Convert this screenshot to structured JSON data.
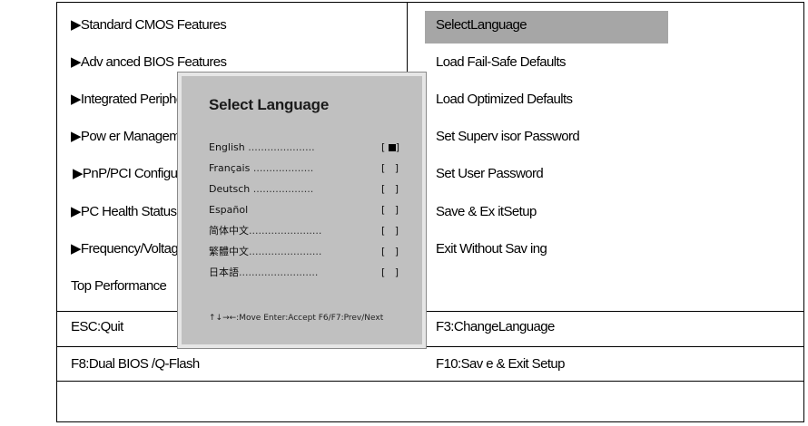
{
  "left_menu": [
    "▶Standard CMOS Features",
    "▶Adv anced BIOS Features",
    "▶Integrated Peripherals",
    "▶Pow er Management Setup",
    "▶PnP/PCI Configurations",
    "▶PC Health Status",
    "▶Frequency/Voltage Control",
    "Top Performance"
  ],
  "right_menu": [
    "SelectLanguage",
    "Load Fail-Safe Defaults",
    "Load Optimized Defaults",
    "Set Superv isor Password",
    "Set User Password",
    "Save & Ex itSetup",
    "Exit Without Sav ing"
  ],
  "footer": {
    "esc": "ESC:Quit",
    "f3": "F3:ChangeLanguage",
    "f8": "F8:Dual BIOS /Q-Flash",
    "f10": "F10:Sav e & Exit Setup"
  },
  "popup": {
    "title": "Select Language",
    "languages": [
      {
        "name": "English",
        "selected": true
      },
      {
        "name": "Français",
        "selected": false
      },
      {
        "name": "Deutsch",
        "selected": false
      },
      {
        "name": "Español",
        "selected": false
      },
      {
        "name": "简体中文",
        "selected": false
      },
      {
        "name": "繁體中文",
        "selected": false
      },
      {
        "name": "日本語",
        "selected": false
      }
    ],
    "hint": "↑↓→←:Move  Enter:Accept  F6/F7:Prev/Next"
  }
}
